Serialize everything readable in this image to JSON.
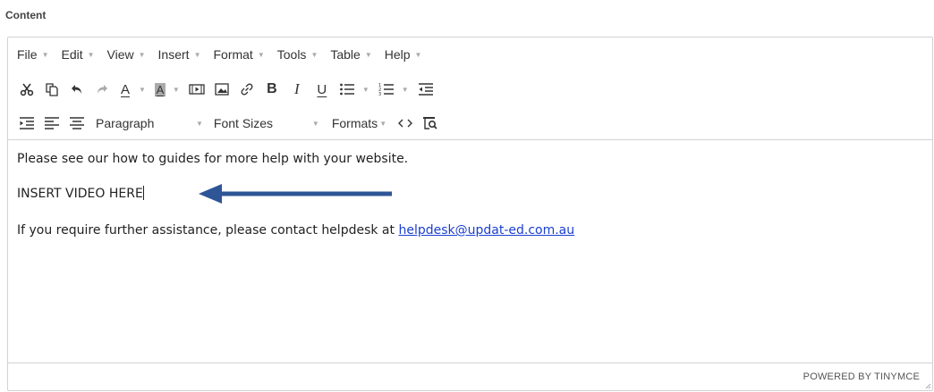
{
  "section_label": "Content",
  "menubar": {
    "items": [
      {
        "label": "File"
      },
      {
        "label": "Edit"
      },
      {
        "label": "View"
      },
      {
        "label": "Insert"
      },
      {
        "label": "Format"
      },
      {
        "label": "Tools"
      },
      {
        "label": "Table"
      },
      {
        "label": "Help"
      }
    ]
  },
  "toolbar": {
    "paragraph_label": "Paragraph",
    "font_sizes_label": "Font Sizes",
    "formats_label": "Formats",
    "bold_glyph": "B",
    "italic_glyph": "I",
    "underline_glyph": "U",
    "text_color_glyph": "A",
    "bg_color_glyph": "A"
  },
  "content": {
    "line1": "Please see our how to guides for more help with your website.",
    "line2": "INSERT VIDEO HERE",
    "line3_prefix": "If you require further assistance, please contact helpdesk at ",
    "line3_link": "helpdesk@updat-ed.com.au"
  },
  "statusbar": {
    "powered_by": "POWERED BY TINYMCE"
  },
  "colors": {
    "arrow": "#2e5596",
    "link": "#1a3fd0",
    "border": "#d2d2d2"
  }
}
